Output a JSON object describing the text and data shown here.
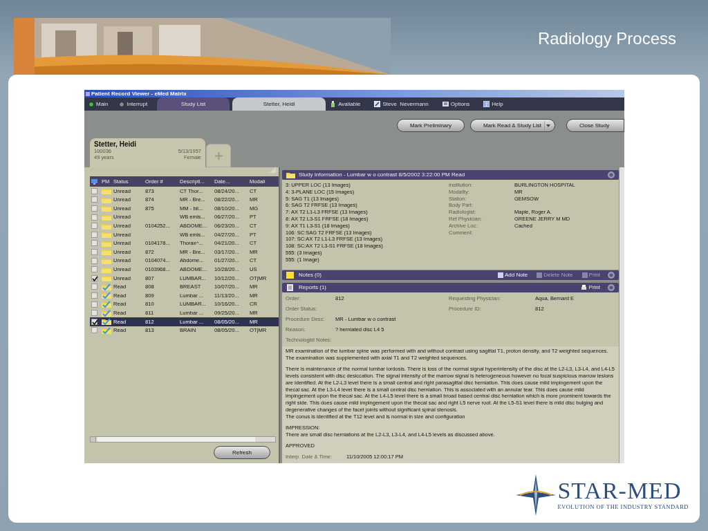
{
  "slide": {
    "title": "Radiology Process",
    "logo": {
      "name": "STAR-MED",
      "tagline": "EVOLUTION OF THE INDUSTRY STANDARD"
    }
  },
  "window": {
    "title": "Patient Record Viewer - eMed Matrix"
  },
  "modes": [
    {
      "label": "Main",
      "selected": true
    },
    {
      "label": "Interrupt",
      "selected": false
    }
  ],
  "tabs": [
    {
      "label": "Study List",
      "selected": false
    },
    {
      "label": "Stetter, Heidi",
      "selected": true
    }
  ],
  "menu": [
    {
      "label": "Available",
      "kind": "status"
    },
    {
      "label": "Steve  Nevermann",
      "kind": "user"
    },
    {
      "label": "Options",
      "kind": "options"
    },
    {
      "label": "Help",
      "kind": "help"
    }
  ],
  "actions": [
    {
      "label": "Mark Preliminary",
      "dropdown": false
    },
    {
      "label": "Mark Read & Study List",
      "dropdown": true
    },
    {
      "label": "Close Study",
      "dropdown": false
    }
  ],
  "patient": {
    "name": "Stetter, Heidi",
    "id": "100036",
    "dob": "5/13/1957",
    "age": "49 years",
    "sex": "Female"
  },
  "study_list": {
    "columns": [
      "PM",
      "Status",
      "Order #",
      "Descripti...",
      "Date...",
      "Modali"
    ],
    "rows": [
      {
        "checked": false,
        "selected": false,
        "kind": "unread",
        "status": "Unread",
        "order": "873",
        "description": "CT Thor...",
        "date": "08/24/20...",
        "modality": "CT"
      },
      {
        "checked": false,
        "selected": false,
        "kind": "unread",
        "status": "Unread",
        "order": "874",
        "description": "MR - Bre...",
        "date": "08/22/20...",
        "modality": "MR"
      },
      {
        "checked": false,
        "selected": false,
        "kind": "unread",
        "status": "Unread",
        "order": "875",
        "description": "MM - bil...",
        "date": "08/10/20...",
        "modality": "MG"
      },
      {
        "checked": false,
        "selected": false,
        "kind": "unread",
        "status": "Unread",
        "description": "WB emis...",
        "date": "06/27/20...",
        "modality": "PT"
      },
      {
        "checked": false,
        "selected": false,
        "kind": "unread",
        "status": "Unread",
        "order": "0104252...",
        "description": "ABDOME...",
        "date": "06/23/20...",
        "modality": "CT"
      },
      {
        "checked": false,
        "selected": false,
        "kind": "unread",
        "status": "Unread",
        "description": "WB emis...",
        "date": "04/27/20...",
        "modality": "PT"
      },
      {
        "checked": false,
        "selected": false,
        "kind": "unread",
        "status": "Unread",
        "order": "0104178...",
        "description": "Thorax^...",
        "date": "04/21/20...",
        "modality": "CT"
      },
      {
        "checked": false,
        "selected": false,
        "kind": "unread",
        "status": "Unread",
        "order": "872",
        "description": "MR - Bre...",
        "date": "03/17/20...",
        "modality": "MR"
      },
      {
        "checked": false,
        "selected": false,
        "kind": "unread",
        "status": "Unread",
        "order": "0104074...",
        "description": "Abdome...",
        "date": "01/27/20...",
        "modality": "CT"
      },
      {
        "checked": false,
        "selected": false,
        "kind": "unread",
        "status": "Unread",
        "order": "0103968...",
        "description": "ABDOME...",
        "date": "10/28/20...",
        "modality": "US"
      },
      {
        "checked": true,
        "selected": false,
        "kind": "unread",
        "status": "Unread",
        "order": "807",
        "description": "LUMBAR...",
        "date": "10/12/20...",
        "modality": "OT|MR"
      },
      {
        "checked": false,
        "selected": false,
        "kind": "read",
        "status": "Read",
        "order": "808",
        "description": "BREAST",
        "date": "10/07/20...",
        "modality": "MR"
      },
      {
        "checked": false,
        "selected": false,
        "kind": "read",
        "status": "Read",
        "order": "809",
        "description": "Lumbar ...",
        "date": "11/13/20...",
        "modality": "MR"
      },
      {
        "checked": false,
        "selected": false,
        "kind": "read",
        "status": "Read",
        "order": "810",
        "description": "LUMBAR...",
        "date": "10/16/20...",
        "modality": "CR"
      },
      {
        "checked": false,
        "selected": false,
        "kind": "read",
        "status": "Read",
        "order": "811",
        "description": "Lumbar ...",
        "date": "09/25/20...",
        "modality": "MR"
      },
      {
        "checked": true,
        "selected": true,
        "kind": "read",
        "status": "Read",
        "order": "812",
        "description": "Lumbar ...",
        "date": "08/05/20...",
        "modality": "MR"
      },
      {
        "checked": false,
        "selected": false,
        "kind": "read",
        "status": "Read",
        "order": "813",
        "description": "BRAIN",
        "date": "08/05/20...",
        "modality": "OT|MR"
      }
    ],
    "refresh": "Refresh"
  },
  "study_info": {
    "title": "Study Information - Lumbar w o contrast 8/5/2002 3:22:00 PM Read",
    "series": [
      "3: UPPER LOC (13 Images)",
      "4: 3-PLANE LOC (15 Images)",
      "5: SAG T1 (13 Images)",
      "6: SAG T2 FRFSE (13 Images)",
      "7: AX T2 L1-L3 FRFSE (13 Images)",
      "8: AX T2 L3-S1 FRFSE (18 Images)",
      "9: AX T1 L3-S1 (18 Images)",
      "106: SC:SAG T2 FRFSE (13 Images)",
      "107: SC:AX T2 L1-L3 FRFSE (13 Images)",
      "108: SC:AX T2 L3-S1 FRFSE (18 Images)",
      "555:  (3 Images)",
      "555:  (1 Image)"
    ],
    "fields": [
      {
        "label": "Institution:",
        "value": "BURLINGTON HOSPITAL"
      },
      {
        "label": "Modality:",
        "value": "MR"
      },
      {
        "label": "Station:",
        "value": "GEMSOW"
      },
      {
        "label": "Body Part:"
      },
      {
        "label": "Radiologist:",
        "value": "Maple, Roger A."
      },
      {
        "label": "Ref Physician:",
        "value": "GREENE JERRY M MD"
      },
      {
        "label": "Archive Loc:",
        "value": "Cached"
      },
      {
        "label": "Comment:"
      }
    ]
  },
  "notes": {
    "title": "Notes (0)",
    "actions": [
      {
        "label": "Add Note",
        "disabled": false
      },
      {
        "label": "Delete Note",
        "disabled": true
      },
      {
        "label": "Print",
        "disabled": true
      }
    ]
  },
  "reports": {
    "title": "Reports (1)",
    "print": "Print",
    "fields": [
      [
        {
          "label": "Order:",
          "value": "812"
        },
        {
          "label": "Requesting Physician:",
          "value": "Aqua, Bernard E"
        }
      ],
      [
        {
          "label": "Order Status:"
        },
        {
          "label": "Procedure ID:",
          "value": "812"
        }
      ],
      [
        {
          "label": "Procedure Desc:",
          "value": "MR - Lumbar w o contrast"
        }
      ],
      [
        {
          "label": "Reason:",
          "value": "? herniated disc L4 5"
        }
      ],
      [
        {
          "label": "Technologist Notes:"
        }
      ]
    ],
    "text": [
      [
        "MR examination of the lumbar spine was performed with and without contrast using sagittal T1, proton density, and T2 weighted sequences. The examination was supplemented with axial T1 and T2 weighted sequences."
      ],
      [
        "There is maintenance of the normal lumbar lordosis. There is loss of the normal signal hyperintensity of the disc at the L2-L3, L3-L4, and L4-L5 levels consistent with disc desiccation. The signal intensity of the marrow signal is heterogeneous however no focal suspicious marrow lesions are identified. At the L2-L3 level there is a small central and right parasagittal disc herniation. This does cause mild impingement upon the thecal sac. At the L3-L4 level there is a small central disc herniation. This is associated with an annular tear. This does cause mild impingement upon the thecal sac. At the L4-L5 level there is a small broad based central disc herniation which is more prominent towards the right side. This does cause mild impingement upon the thecal sac and right L5 nerve root. At the L5-S1 level there is mild disc bulging and degenerative changes of the facet joints without significant spinal stenosis.",
        "The conus is identified at the T12 level and is normal in size and configuration"
      ],
      [
        "IMPRESSION:",
        "There are small disc herniations at the L2-L3, L3-L4, and L4-L5 levels as discussed above."
      ],
      [
        "APPROVED"
      ]
    ],
    "footer": {
      "label": "Interp. Date & Time:",
      "value": "11/10/2005 12:00:17 PM"
    }
  }
}
